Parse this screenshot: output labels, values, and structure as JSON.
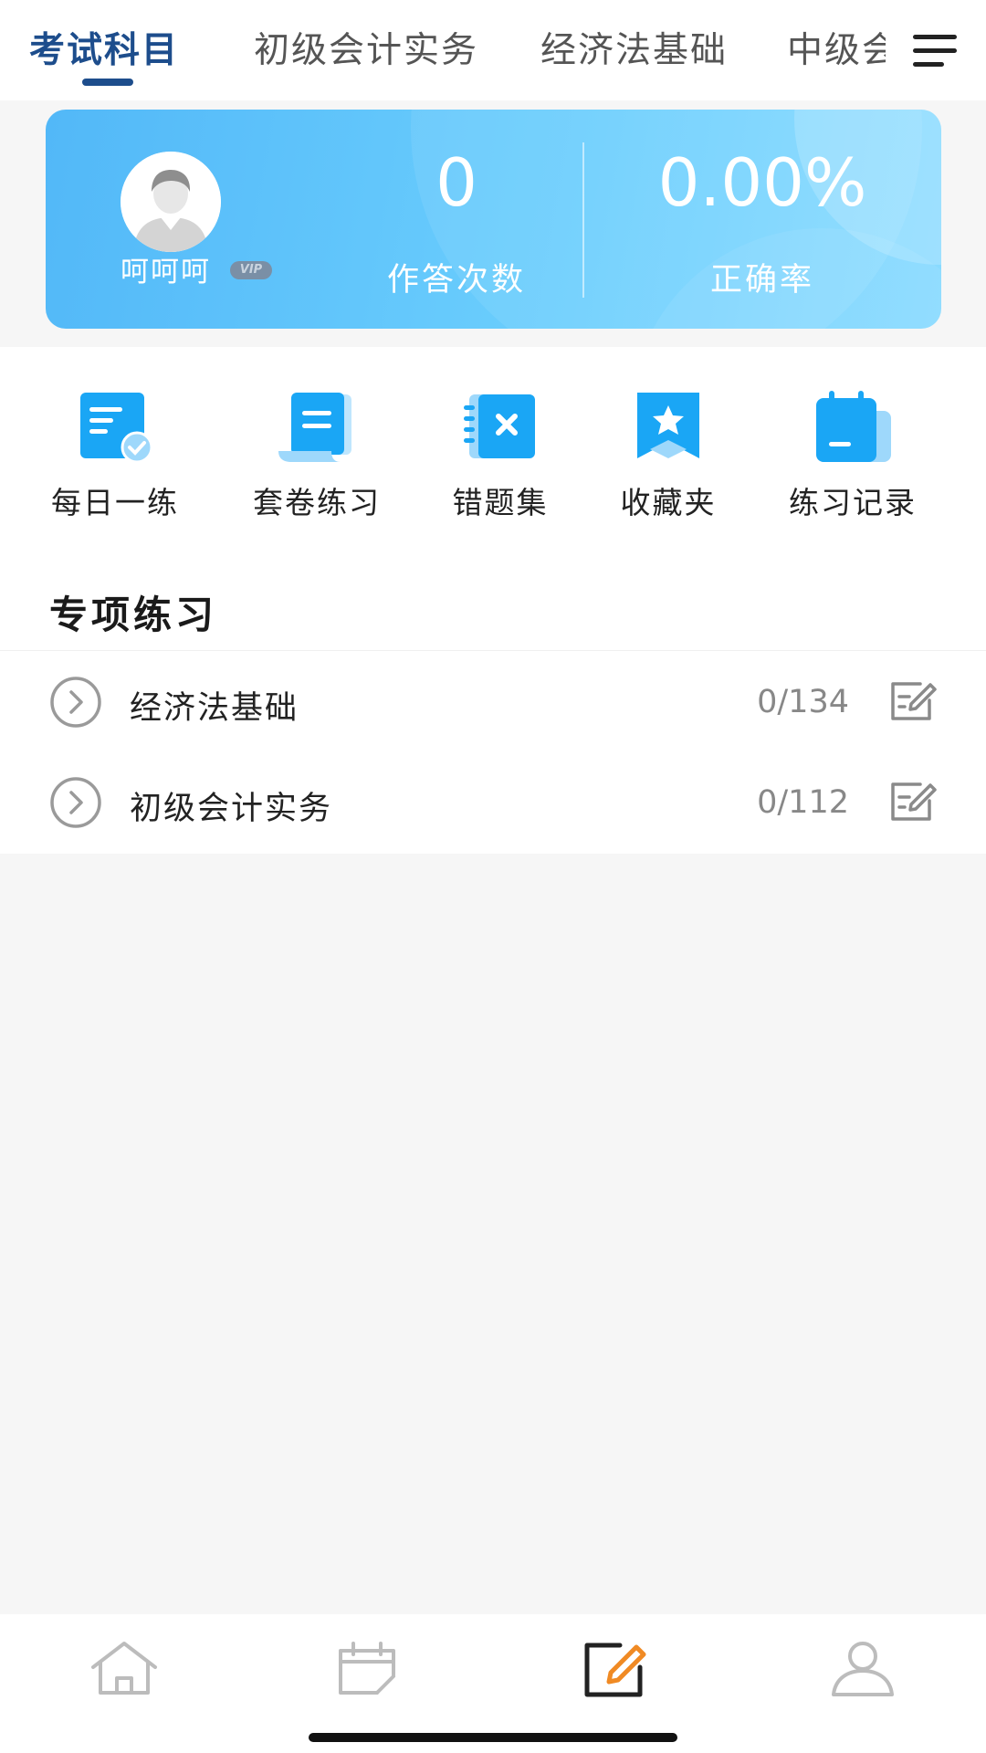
{
  "tabs": [
    {
      "label": "考试科目",
      "active": true
    },
    {
      "label": "初级会计实务",
      "active": false
    },
    {
      "label": "经济法基础",
      "active": false
    },
    {
      "label": "中级会",
      "active": false
    }
  ],
  "header": {
    "menu_icon": "menu-icon"
  },
  "stats_card": {
    "username": "呵呵呵",
    "vip_label": "VIP",
    "answer_count": "0",
    "answer_count_label": "作答次数",
    "accuracy": "0.00%",
    "accuracy_label": "正确率"
  },
  "quick_actions": [
    {
      "label": "每日一练",
      "icon": "daily-practice-icon"
    },
    {
      "label": "套卷练习",
      "icon": "paper-set-icon"
    },
    {
      "label": "错题集",
      "icon": "wrong-questions-icon"
    },
    {
      "label": "收藏夹",
      "icon": "favorites-icon"
    },
    {
      "label": "练习记录",
      "icon": "practice-record-icon"
    }
  ],
  "special_practice": {
    "title": "专项练习",
    "items": [
      {
        "name": "经济法基础",
        "progress": "0/134"
      },
      {
        "name": "初级会计实务",
        "progress": "0/112"
      }
    ]
  },
  "bottom_nav": [
    {
      "icon": "home-icon",
      "active": false
    },
    {
      "icon": "calendar-icon",
      "active": false
    },
    {
      "icon": "practice-edit-icon",
      "active": true
    },
    {
      "icon": "profile-icon",
      "active": false
    }
  ],
  "colors": {
    "accent": "#1d4d8c",
    "card_blue": "#5cc4fb",
    "icon_blue": "#1aa6f5",
    "active_nav_orange": "#f08a24"
  }
}
